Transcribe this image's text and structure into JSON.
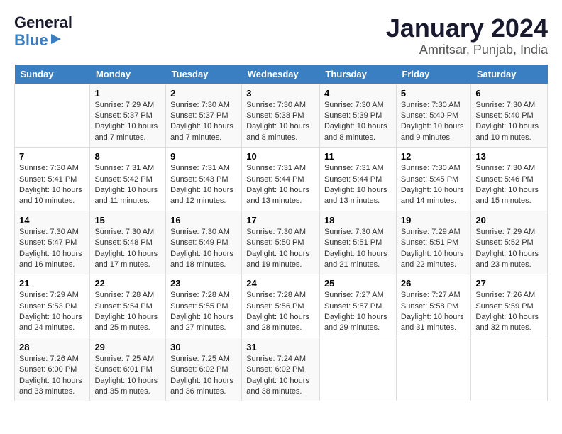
{
  "logo": {
    "general": "General",
    "blue": "Blue"
  },
  "title": "January 2024",
  "location": "Amritsar, Punjab, India",
  "days_of_week": [
    "Sunday",
    "Monday",
    "Tuesday",
    "Wednesday",
    "Thursday",
    "Friday",
    "Saturday"
  ],
  "weeks": [
    [
      {
        "day": "",
        "info": ""
      },
      {
        "day": "1",
        "info": "Sunrise: 7:29 AM\nSunset: 5:37 PM\nDaylight: 10 hours\nand 7 minutes."
      },
      {
        "day": "2",
        "info": "Sunrise: 7:30 AM\nSunset: 5:37 PM\nDaylight: 10 hours\nand 7 minutes."
      },
      {
        "day": "3",
        "info": "Sunrise: 7:30 AM\nSunset: 5:38 PM\nDaylight: 10 hours\nand 8 minutes."
      },
      {
        "day": "4",
        "info": "Sunrise: 7:30 AM\nSunset: 5:39 PM\nDaylight: 10 hours\nand 8 minutes."
      },
      {
        "day": "5",
        "info": "Sunrise: 7:30 AM\nSunset: 5:40 PM\nDaylight: 10 hours\nand 9 minutes."
      },
      {
        "day": "6",
        "info": "Sunrise: 7:30 AM\nSunset: 5:40 PM\nDaylight: 10 hours\nand 10 minutes."
      }
    ],
    [
      {
        "day": "7",
        "info": "Sunrise: 7:30 AM\nSunset: 5:41 PM\nDaylight: 10 hours\nand 10 minutes."
      },
      {
        "day": "8",
        "info": "Sunrise: 7:31 AM\nSunset: 5:42 PM\nDaylight: 10 hours\nand 11 minutes."
      },
      {
        "day": "9",
        "info": "Sunrise: 7:31 AM\nSunset: 5:43 PM\nDaylight: 10 hours\nand 12 minutes."
      },
      {
        "day": "10",
        "info": "Sunrise: 7:31 AM\nSunset: 5:44 PM\nDaylight: 10 hours\nand 13 minutes."
      },
      {
        "day": "11",
        "info": "Sunrise: 7:31 AM\nSunset: 5:44 PM\nDaylight: 10 hours\nand 13 minutes."
      },
      {
        "day": "12",
        "info": "Sunrise: 7:30 AM\nSunset: 5:45 PM\nDaylight: 10 hours\nand 14 minutes."
      },
      {
        "day": "13",
        "info": "Sunrise: 7:30 AM\nSunset: 5:46 PM\nDaylight: 10 hours\nand 15 minutes."
      }
    ],
    [
      {
        "day": "14",
        "info": "Sunrise: 7:30 AM\nSunset: 5:47 PM\nDaylight: 10 hours\nand 16 minutes."
      },
      {
        "day": "15",
        "info": "Sunrise: 7:30 AM\nSunset: 5:48 PM\nDaylight: 10 hours\nand 17 minutes."
      },
      {
        "day": "16",
        "info": "Sunrise: 7:30 AM\nSunset: 5:49 PM\nDaylight: 10 hours\nand 18 minutes."
      },
      {
        "day": "17",
        "info": "Sunrise: 7:30 AM\nSunset: 5:50 PM\nDaylight: 10 hours\nand 19 minutes."
      },
      {
        "day": "18",
        "info": "Sunrise: 7:30 AM\nSunset: 5:51 PM\nDaylight: 10 hours\nand 21 minutes."
      },
      {
        "day": "19",
        "info": "Sunrise: 7:29 AM\nSunset: 5:51 PM\nDaylight: 10 hours\nand 22 minutes."
      },
      {
        "day": "20",
        "info": "Sunrise: 7:29 AM\nSunset: 5:52 PM\nDaylight: 10 hours\nand 23 minutes."
      }
    ],
    [
      {
        "day": "21",
        "info": "Sunrise: 7:29 AM\nSunset: 5:53 PM\nDaylight: 10 hours\nand 24 minutes."
      },
      {
        "day": "22",
        "info": "Sunrise: 7:28 AM\nSunset: 5:54 PM\nDaylight: 10 hours\nand 25 minutes."
      },
      {
        "day": "23",
        "info": "Sunrise: 7:28 AM\nSunset: 5:55 PM\nDaylight: 10 hours\nand 27 minutes."
      },
      {
        "day": "24",
        "info": "Sunrise: 7:28 AM\nSunset: 5:56 PM\nDaylight: 10 hours\nand 28 minutes."
      },
      {
        "day": "25",
        "info": "Sunrise: 7:27 AM\nSunset: 5:57 PM\nDaylight: 10 hours\nand 29 minutes."
      },
      {
        "day": "26",
        "info": "Sunrise: 7:27 AM\nSunset: 5:58 PM\nDaylight: 10 hours\nand 31 minutes."
      },
      {
        "day": "27",
        "info": "Sunrise: 7:26 AM\nSunset: 5:59 PM\nDaylight: 10 hours\nand 32 minutes."
      }
    ],
    [
      {
        "day": "28",
        "info": "Sunrise: 7:26 AM\nSunset: 6:00 PM\nDaylight: 10 hours\nand 33 minutes."
      },
      {
        "day": "29",
        "info": "Sunrise: 7:25 AM\nSunset: 6:01 PM\nDaylight: 10 hours\nand 35 minutes."
      },
      {
        "day": "30",
        "info": "Sunrise: 7:25 AM\nSunset: 6:02 PM\nDaylight: 10 hours\nand 36 minutes."
      },
      {
        "day": "31",
        "info": "Sunrise: 7:24 AM\nSunset: 6:02 PM\nDaylight: 10 hours\nand 38 minutes."
      },
      {
        "day": "",
        "info": ""
      },
      {
        "day": "",
        "info": ""
      },
      {
        "day": "",
        "info": ""
      }
    ]
  ]
}
